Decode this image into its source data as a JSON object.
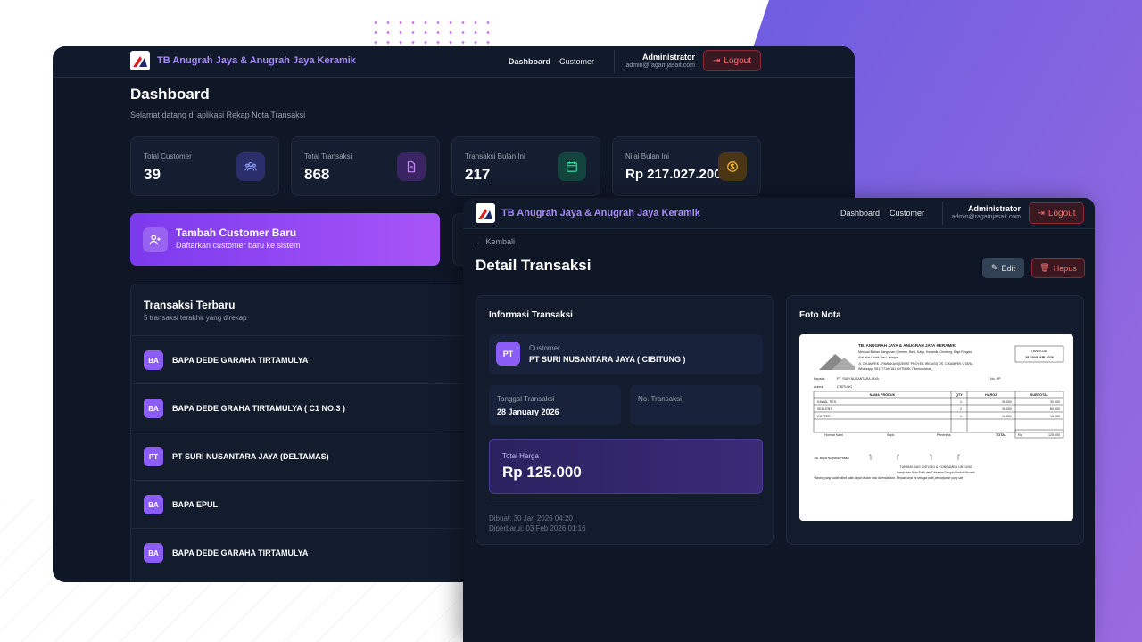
{
  "brand": {
    "name": "TB Anugrah Jaya & Anugrah Jaya Keramik"
  },
  "nav": {
    "dashboard": "Dashboard",
    "customer": "Customer"
  },
  "user": {
    "name": "Administrator",
    "email": "admin@ragamjasait.com",
    "logout": "Logout"
  },
  "dashboard": {
    "title": "Dashboard",
    "subtitle": "Selamat datang di aplikasi Rekap Nota Transaksi",
    "stats": [
      {
        "label": "Total Customer",
        "value": "39",
        "icon": "users-icon",
        "color": "#6d7cf0"
      },
      {
        "label": "Total Transaksi",
        "value": "868",
        "icon": "document-icon",
        "color": "#b47af5"
      },
      {
        "label": "Transaksi Bulan Ini",
        "value": "217",
        "icon": "calendar-icon",
        "color": "#34d399"
      },
      {
        "label": "Nilai Bulan Ini",
        "value": "Rp 217.027.200",
        "icon": "coin-icon",
        "color": "#f5b82e"
      }
    ],
    "cta": {
      "title": "Tambah Customer Baru",
      "subtitle": "Daftarkan customer baru ke sistem"
    },
    "recent": {
      "title": "Transaksi Terbaru",
      "subtitle": "5 transaksi terakhir yang direkap",
      "items": [
        {
          "initials": "BA",
          "name": "BAPA DEDE GARAHA TIRTAMULYA"
        },
        {
          "initials": "BA",
          "name": "BAPA DEDE GRAHA TIRTAMULYA ( C1 NO.3 )"
        },
        {
          "initials": "PT",
          "name": "PT SURI NUSANTARA JAYA (DELTAMAS)"
        },
        {
          "initials": "BA",
          "name": "BAPA EPUL"
        },
        {
          "initials": "BA",
          "name": "BAPA DEDE GARAHA TIRTAMULYA"
        }
      ]
    }
  },
  "detail": {
    "back": "Kembali",
    "title": "Detail Transaksi",
    "edit": "Edit",
    "delete": "Hapus",
    "info_title": "Informasi Transaksi",
    "customer_label": "Customer",
    "customer_initials": "PT",
    "customer_name": "PT SURI NUSANTARA JAYA ( CIBITUNG )",
    "date_label": "Tanggal Transaksi",
    "date_value": "28 January 2026",
    "no_label": "No. Transaksi",
    "total_label": "Total Harga",
    "total_value": "Rp 125.000",
    "created": "Dibuat: 30 Jan 2026 04:20",
    "updated": "Diperbarui: 03 Feb 2026 01:16",
    "photo_title": "Foto Nota"
  },
  "nota": {
    "store": "TB. ANUGRAH JAYA & ANUGRAH JAYA KERAMIK",
    "desc1": "Menjual Bahan Bangunan (Semen, Besi, Kayu, Keramik, Genteng, Baja Ringan)",
    "desc2": "Alat-alat Listrik dan Lainnya",
    "addr": "Jl. CIKAMPEK - PAWAKAN (DEKAT PROYEK IRIGASI) DS. CIKAMPEK UTARA",
    "phone": "Whatsapp/ 0817771e6181 KHTMMK 7Bemurklalus_",
    "tgl_label": "TANGGAL",
    "tgl_value": "28 JANUARI 2026",
    "kepada_label": "Kepada",
    "kepada_value": "PT. SURI NUSANTARA JAYA",
    "alamat_label": "Alamat",
    "alamat_value": "CIBITUNG",
    "nohp_label": "No. HP",
    "headers": [
      "NAMA PRODUK",
      "QTY",
      "HARGA",
      "SUBTOTAL"
    ],
    "rows": [
      {
        "name": "KAWAL TIES",
        "qty": "1",
        "price": "30.000",
        "subtotal": "30.000"
      },
      {
        "name": "SEALENT",
        "qty": "2",
        "price": "40.000",
        "subtotal": "80.000"
      },
      {
        "name": "CUTTER",
        "qty": "1",
        "price": "15.000",
        "subtotal": "15.000"
      }
    ],
    "hormat": "Hormat Kami",
    "supir": "Supir,",
    "penerima": "Penerima,",
    "total_label": "TOTAL",
    "total_rp": "Rp",
    "total_value": "125.000",
    "sign_label": "Ttd. Bapa Nugraha Pesanl",
    "foot1": "TUKANG BAS UNTUNG & KONSUMEN UNTUNG",
    "foot2": "Kemjuakan Nota Putih dan Tulisahan Dengan Hadiah Menarik",
    "foot3": "*Barang yang sudah dibeli tidak dapat ditukar atau dikembalikan. Simpan struk ini sebagai bukti pembayaran yang sah"
  }
}
